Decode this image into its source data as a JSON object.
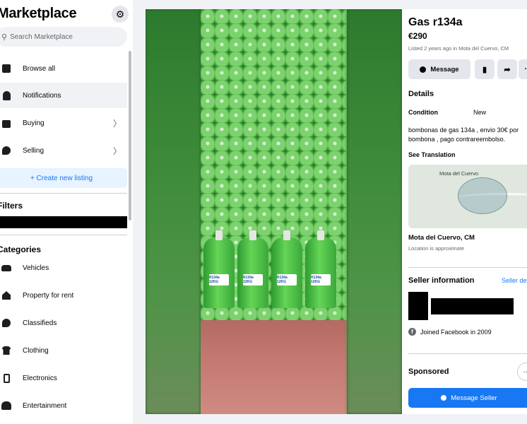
{
  "sidebar": {
    "title": "Marketplace",
    "search_placeholder": "Search Marketplace",
    "nav": [
      {
        "label": "Browse all",
        "icon": "storefront-icon"
      },
      {
        "label": "Notifications",
        "icon": "bell-icon"
      },
      {
        "label": "Buying",
        "icon": "shopping-bag-icon"
      },
      {
        "label": "Selling",
        "icon": "tag-icon"
      }
    ],
    "create_listing": "+ Create new listing",
    "filters_heading": "Filters",
    "categories_heading": "Categories",
    "categories": [
      {
        "label": "Vehicles",
        "icon": "car-icon"
      },
      {
        "label": "Property for rent",
        "icon": "house-icon"
      },
      {
        "label": "Classifieds",
        "icon": "tag-icon"
      },
      {
        "label": "Clothing",
        "icon": "shirt-icon"
      },
      {
        "label": "Electronics",
        "icon": "phone-icon"
      },
      {
        "label": "Entertainment",
        "icon": "people-icon"
      }
    ]
  },
  "photo": {
    "cylinder_label": "R134a 12KG"
  },
  "listing": {
    "title": "Gas r134a",
    "price": "€290",
    "listed": "Listed 2 years ago in Mota del Cuervo, CM",
    "message_button": "Message",
    "details_heading": "Details",
    "condition_label": "Condition",
    "condition_value": "New",
    "description": "bombonas de gas 134a , envio 30€ por bombona , pago contrareembolso.",
    "see_translation": "See Translation",
    "map_label": "Mota del Cuervo",
    "location": "Mota del Cuervo, CM",
    "location_note": "Location is approximate",
    "seller_heading": "Seller information",
    "seller_link": "Seller details",
    "joined": "Joined Facebook in 2009",
    "sponsored": "Sponsored",
    "message_seller": "Message Seller"
  },
  "colors": {
    "accent": "#1877f2",
    "background": "#f0f2f5"
  }
}
